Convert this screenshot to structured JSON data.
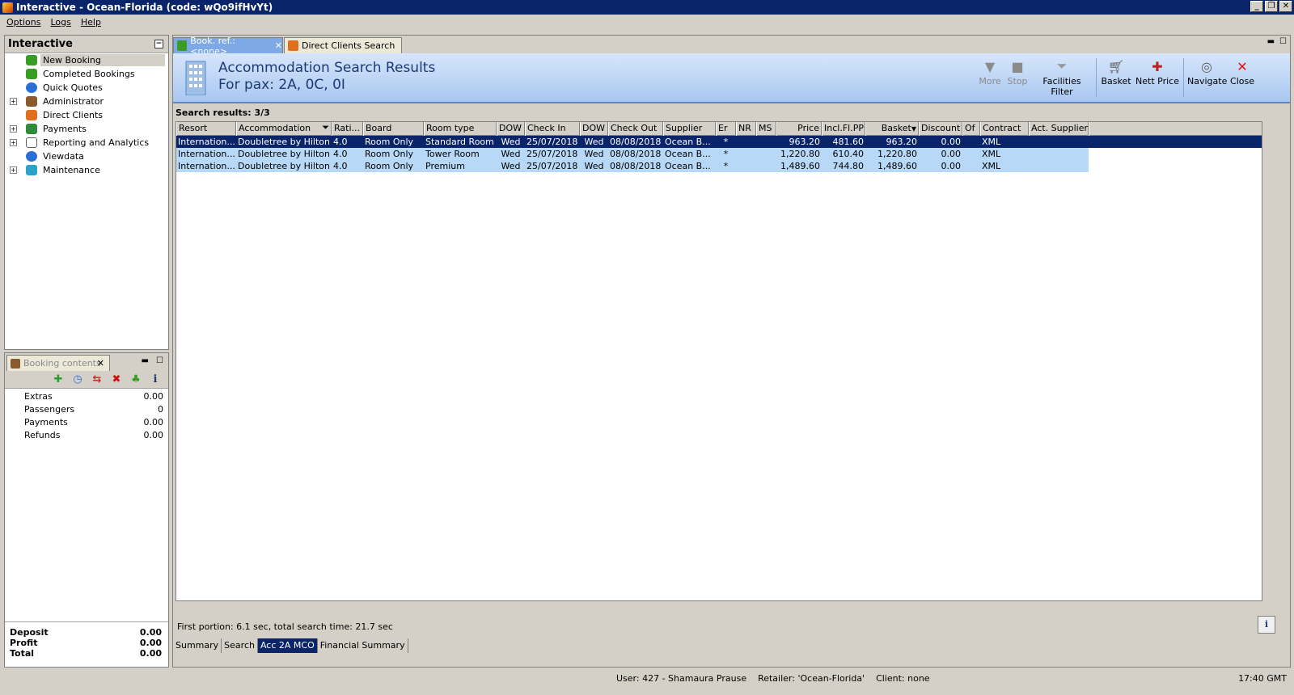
{
  "window": {
    "title": "Interactive - Ocean-Florida (code: wQo9ifHvYt)"
  },
  "menu": [
    "Options",
    "Logs",
    "Help"
  ],
  "nav": {
    "title": "Interactive",
    "items": [
      {
        "label": "New Booking",
        "icon": "palm-tree-icon",
        "color": "#3a9d23"
      },
      {
        "label": "Completed Bookings",
        "icon": "palm-tree-icon",
        "color": "#3a9d23"
      },
      {
        "label": "Quick Quotes",
        "icon": "clock-icon",
        "color": "#2a6fd6"
      },
      {
        "label": "Administrator",
        "icon": "admin-person-icon",
        "color": "#8a5a2b"
      },
      {
        "label": "Direct Clients",
        "icon": "direct-client-icon",
        "color": "#e07020"
      },
      {
        "label": "Payments",
        "icon": "payments-icon",
        "color": "#2f8a3a"
      },
      {
        "label": "Reporting and Analytics",
        "icon": "report-icon",
        "color": "#606060"
      },
      {
        "label": "Viewdata",
        "icon": "globe-icon",
        "color": "#2a6fd6"
      },
      {
        "label": "Maintenance",
        "icon": "maintenance-box-icon",
        "color": "#2aa3c8"
      }
    ]
  },
  "booking": {
    "tab_label": "Booking contents",
    "rows": [
      {
        "label": "Extras",
        "value": "0.00"
      },
      {
        "label": "Passengers",
        "value": "0"
      },
      {
        "label": "Payments",
        "value": "0.00"
      },
      {
        "label": "Refunds",
        "value": "0.00"
      }
    ],
    "totals": [
      {
        "label": "Deposit",
        "value": "0.00"
      },
      {
        "label": "Profit",
        "value": "0.00"
      },
      {
        "label": "Total",
        "value": "0.00"
      }
    ]
  },
  "main": {
    "tabs": [
      {
        "label": "Book. ref.: <none>"
      },
      {
        "label": "Direct Clients Search"
      }
    ],
    "banner_title": "Accommodation Search Results",
    "banner_subtitle": "For pax: 2A, 0C, 0I",
    "toolbar": {
      "more": "More",
      "stop": "Stop",
      "facilities": "Facilities Filter",
      "basket": "Basket",
      "nett": "Nett Price",
      "navigate": "Navigate",
      "close": "Close"
    },
    "results_label": "Search results: 3/3",
    "columns": [
      "Resort",
      "Accommodation",
      "Rati...",
      "Board",
      "Room type",
      "DOW",
      "Check In",
      "DOW",
      "Check Out",
      "Supplier",
      "Er",
      "NR",
      "MS",
      "Price",
      "Incl.Fl.PP",
      "Basket",
      "Discount",
      "Of",
      "Contract",
      "Act. Supplier"
    ],
    "rows": [
      [
        "Internation...",
        "Doubletree by Hilton ...",
        "4.0",
        "Room Only",
        "Standard Room",
        "Wed",
        "25/07/2018",
        "Wed",
        "08/08/2018",
        "Ocean B...",
        "*",
        "",
        "",
        "963.20",
        "481.60",
        "963.20",
        "0.00",
        "",
        "XML",
        ""
      ],
      [
        "Internation...",
        "Doubletree by Hilton ...",
        "4.0",
        "Room Only",
        "Tower Room",
        "Wed",
        "25/07/2018",
        "Wed",
        "08/08/2018",
        "Ocean B...",
        "*",
        "",
        "",
        "1,220.80",
        "610.40",
        "1,220.80",
        "0.00",
        "",
        "XML",
        ""
      ],
      [
        "Internation...",
        "Doubletree by Hilton ...",
        "4.0",
        "Room Only",
        "Premium",
        "Wed",
        "25/07/2018",
        "Wed",
        "08/08/2018",
        "Ocean B...",
        "*",
        "",
        "",
        "1,489.60",
        "744.80",
        "1,489.60",
        "0.00",
        "",
        "XML",
        ""
      ]
    ],
    "search_time": "First portion: 6.1 sec, total search time: 21.7 sec",
    "bottom_tabs": [
      "Summary",
      "Search",
      "Acc 2A MCO",
      "Financial Summary"
    ]
  },
  "status": {
    "user_info": "User: 427 - Shamaura Prause    Retailer: 'Ocean-Florida'    Client: none",
    "time": "17:40 GMT"
  }
}
